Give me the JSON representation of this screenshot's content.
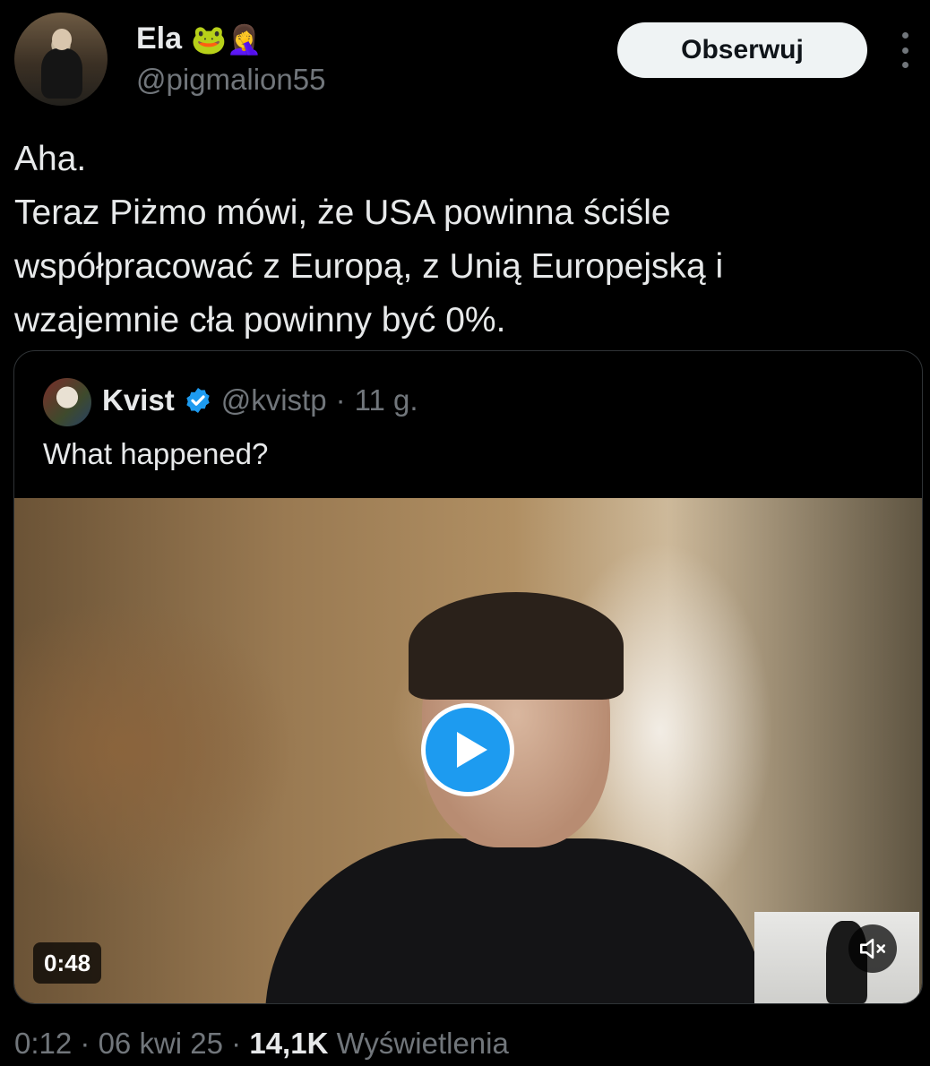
{
  "author": {
    "display_name": "Ela",
    "emojis": "🐸🤦‍♀️",
    "handle": "@pigmalion55",
    "follow_label": "Obserwuj"
  },
  "tweet": {
    "lines": [
      "Aha.",
      "Teraz Piżmo mówi, że USA powinna ściśle",
      "współpracować z Europą, z Unią Europejską i",
      "wzajemnie cła powinny być 0%."
    ]
  },
  "quote": {
    "display_name": "Kvist",
    "handle": "@kvistp",
    "separator": "·",
    "age": "11 g.",
    "text": "What happened?",
    "video": {
      "duration": "0:48"
    }
  },
  "footer": {
    "time": "0:12",
    "separator": "·",
    "date": "06 kwi 25",
    "views_count": "14,1K",
    "views_label": "Wyświetlenia"
  },
  "colors": {
    "accent": "#1d9bf0",
    "text_primary": "#e7e9ea",
    "text_secondary": "#71767b",
    "background": "#000000"
  }
}
